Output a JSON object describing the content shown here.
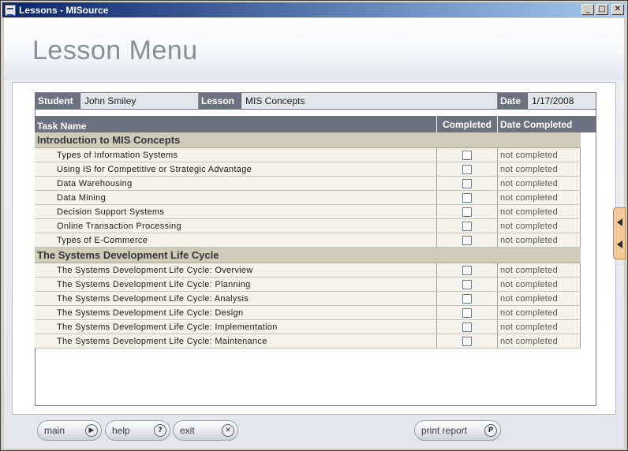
{
  "window": {
    "title": "Lessons - MISource",
    "min": "_",
    "max": "□",
    "close": "✕"
  },
  "page_title": "Lesson Menu",
  "info": {
    "student_label": "Student",
    "student_value": "John Smiley",
    "lesson_label": "Lesson",
    "lesson_value": "MIS Concepts",
    "date_label": "Date",
    "date_value": "1/17/2008"
  },
  "table": {
    "headers": {
      "task": "Task Name",
      "completed": "Completed",
      "date": "Date Completed"
    },
    "sections": [
      {
        "title": "Introduction to MIS Concepts",
        "rows": [
          {
            "task": "Types of Information Systems",
            "status": "not completed"
          },
          {
            "task": "Using IS for Competitive or Strategic Advantage",
            "status": "not completed"
          },
          {
            "task": "Data Warehousing",
            "status": "not completed"
          },
          {
            "task": "Data Mining",
            "status": "not completed"
          },
          {
            "task": "Decision Support Systems",
            "status": "not completed"
          },
          {
            "task": "Online Transaction Processing",
            "status": "not completed"
          },
          {
            "task": "Types of E-Commerce",
            "status": "not completed"
          }
        ]
      },
      {
        "title": "The Systems Development Life Cycle",
        "rows": [
          {
            "task": "The Systems Development Life Cycle: Overview",
            "status": "not completed"
          },
          {
            "task": "The Systems Development Life Cycle: Planning",
            "status": "not completed"
          },
          {
            "task": "The Systems Development Life Cycle: Analysis",
            "status": "not completed"
          },
          {
            "task": "The Systems Development Life Cycle: Design",
            "status": "not completed"
          },
          {
            "task": "The Systems Development Life Cycle: Implementation",
            "status": "not completed"
          },
          {
            "task": "The Systems Development Life Cycle: Maintenance",
            "status": "not completed"
          }
        ]
      }
    ]
  },
  "buttons": {
    "main": {
      "label": "main",
      "icon": "▶"
    },
    "help": {
      "label": "help",
      "icon": "?"
    },
    "exit": {
      "label": "exit",
      "icon": "✕"
    },
    "print": {
      "label": "print report",
      "icon": "P"
    }
  }
}
